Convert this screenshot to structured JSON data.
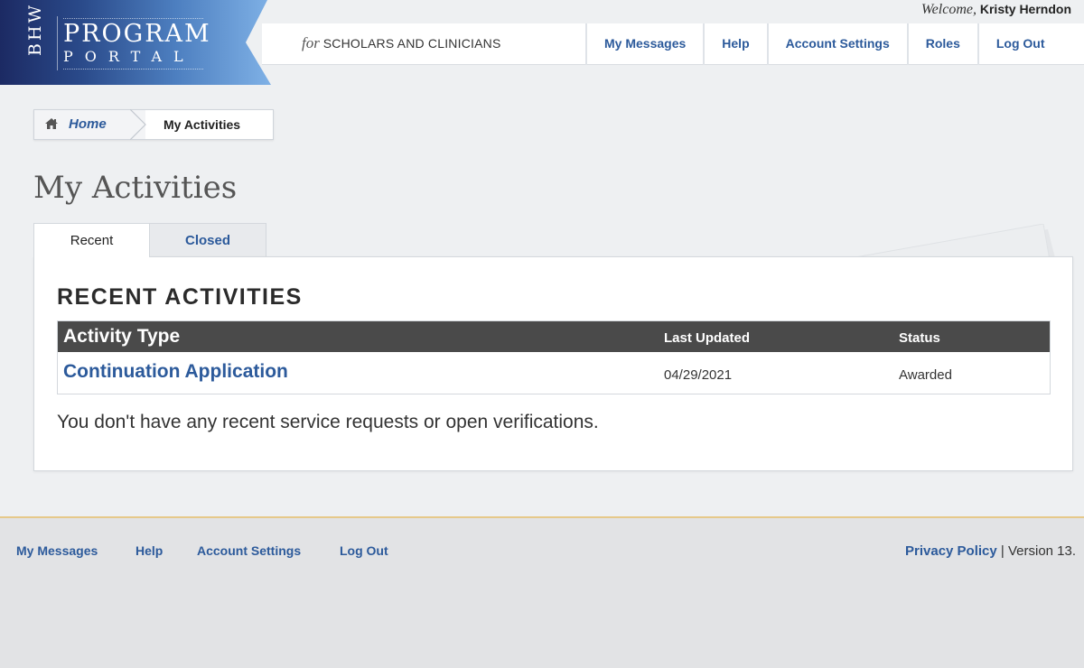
{
  "header": {
    "logo": {
      "side": "BHW",
      "line1": "PROGRAM",
      "line2": "PORTAL"
    },
    "welcome_label": "Welcome,",
    "user_name": "Kristy Herndon",
    "tagline_for": "for",
    "tagline_main": "SCHOLARS AND CLINICIANS",
    "nav": [
      {
        "label": "My Messages"
      },
      {
        "label": "Help"
      },
      {
        "label": "Account Settings"
      },
      {
        "label": "Roles"
      },
      {
        "label": "Log Out"
      }
    ]
  },
  "breadcrumb": {
    "home_label": "Home",
    "current_label": "My Activities"
  },
  "page": {
    "title": "My Activities",
    "tabs": [
      {
        "label": "Recent",
        "active": true
      },
      {
        "label": "Closed",
        "active": false
      }
    ]
  },
  "recent": {
    "heading": "RECENT ACTIVITIES",
    "table": {
      "headers": [
        "Activity Type",
        "Last Updated",
        "Status"
      ],
      "rows": [
        {
          "activity_type": "Continuation Application",
          "last_updated": "04/29/2021",
          "status": "Awarded"
        }
      ]
    },
    "empty_message": "You don't have any recent service requests or open verifications."
  },
  "footer": {
    "nav": [
      {
        "label": "My Messages"
      },
      {
        "label": "Help"
      },
      {
        "label": "Account Settings"
      },
      {
        "label": "Log Out"
      }
    ],
    "privacy_label": "Privacy Policy",
    "separator": "|",
    "version": "Version 13."
  },
  "colors": {
    "link_blue": "#2c5a9b",
    "table_header_bg": "#4a4a4a",
    "logo_dark": "#1c2a63",
    "logo_light": "#7fb1e6",
    "footer_rule": "#e6c98a"
  }
}
